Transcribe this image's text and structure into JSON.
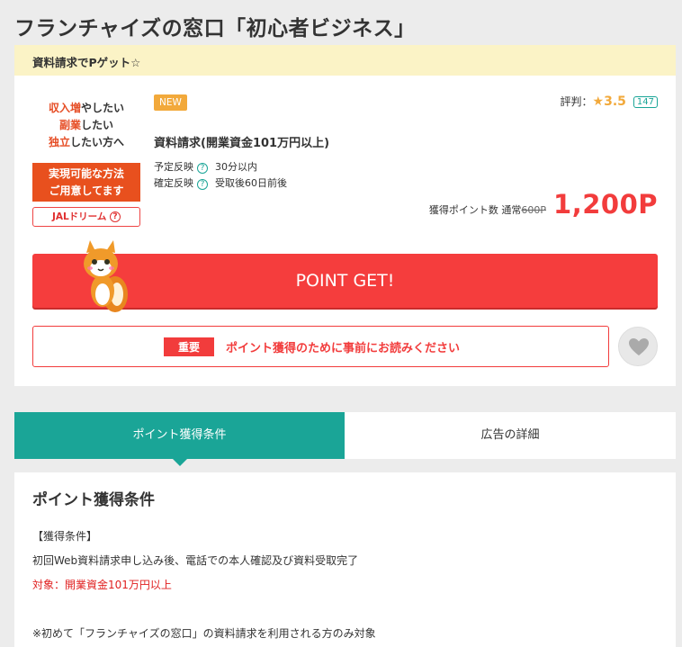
{
  "page": {
    "title": "フランチャイズの窓口「初心者ビジネス」"
  },
  "campaign": {
    "text": "資料請求でPゲット☆"
  },
  "banner": {
    "line1_highlight": "収入増",
    "line1_rest": "やしたい",
    "line2_highlight": "副業",
    "line2_rest": "したい",
    "line3_highlight": "独立",
    "line3_rest": "したい方へ",
    "cta_line1": "実現可能な方法",
    "cta_line2": "ご用意してます",
    "jal_label": "JALドリーム",
    "jal_help": "?"
  },
  "offer": {
    "new_badge": "NEW",
    "name": "資料請求(開業資金101万円以上)",
    "schedule_label": "予定反映",
    "schedule_value": "30分以内",
    "confirm_label": "確定反映",
    "confirm_value": "受取後60日前後",
    "help": "?"
  },
  "rating": {
    "label": "評判：",
    "star": "★3.5",
    "count": "147"
  },
  "points": {
    "label": "獲得ポイント数 通常",
    "old": "600P",
    "value": "1,200P"
  },
  "actions": {
    "get_label": "POINT GET!"
  },
  "notice": {
    "tag": "重要",
    "text": "ポイント獲得のために事前にお読みください"
  },
  "tabs": [
    {
      "label": "ポイント獲得条件"
    },
    {
      "label": "広告の詳細"
    }
  ],
  "conditions": {
    "title": "ポイント獲得条件",
    "section_label": "【獲得条件】",
    "line1": "初回Web資料請求申し込み後、電話での本人確認及び資料受取完了",
    "target": "対象：開業資金101万円以上",
    "note": "※初めて「フランチャイズの窓口」の資料請求を利用される方のみ対象"
  },
  "colors": {
    "accent_teal": "#1aa597",
    "accent_red": "#f53d3d",
    "campaign_bg": "#fbf3c6",
    "star": "#f2a93b"
  },
  "icons": {
    "heart": "heart-icon",
    "mascot": "squirrel-mascot-icon",
    "help": "help-circle-icon"
  }
}
